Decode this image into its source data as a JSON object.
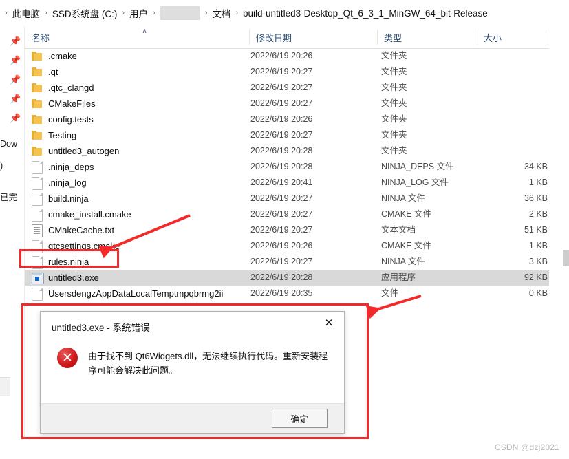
{
  "window": {
    "title": "build-untitled3-Desktop_Qt_6_3_1_MinGW_64_bit-Release"
  },
  "breadcrumb": {
    "separator": "›",
    "items": [
      {
        "label": "此电脑",
        "redacted": false
      },
      {
        "label": "SSD系统盘 (C:)",
        "redacted": false
      },
      {
        "label": "用户",
        "redacted": false
      },
      {
        "label": "",
        "redacted": true
      },
      {
        "label": "文档",
        "redacted": false
      },
      {
        "label": "build-untitled3-Desktop_Qt_6_3_1_MinGW_64_bit-Release",
        "redacted": false
      }
    ]
  },
  "columns": {
    "name": "名称",
    "date_modified": "修改日期",
    "type": "类型",
    "size": "大小",
    "sort_caret": "∧"
  },
  "left_rail": {
    "pin_icon": "📌",
    "fragments": [
      "Dow",
      ")",
      "已完"
    ]
  },
  "files": [
    {
      "name": ".cmake",
      "icon": "folder",
      "date": "2022/6/19 20:26",
      "type": "文件夹",
      "size": "",
      "selected": false
    },
    {
      "name": ".qt",
      "icon": "folder",
      "date": "2022/6/19 20:27",
      "type": "文件夹",
      "size": "",
      "selected": false
    },
    {
      "name": ".qtc_clangd",
      "icon": "folder",
      "date": "2022/6/19 20:27",
      "type": "文件夹",
      "size": "",
      "selected": false
    },
    {
      "name": "CMakeFiles",
      "icon": "folder",
      "date": "2022/6/19 20:27",
      "type": "文件夹",
      "size": "",
      "selected": false
    },
    {
      "name": "config.tests",
      "icon": "folder",
      "date": "2022/6/19 20:26",
      "type": "文件夹",
      "size": "",
      "selected": false
    },
    {
      "name": "Testing",
      "icon": "folder",
      "date": "2022/6/19 20:27",
      "type": "文件夹",
      "size": "",
      "selected": false
    },
    {
      "name": "untitled3_autogen",
      "icon": "folder",
      "date": "2022/6/19 20:28",
      "type": "文件夹",
      "size": "",
      "selected": false
    },
    {
      "name": ".ninja_deps",
      "icon": "file",
      "date": "2022/6/19 20:28",
      "type": "NINJA_DEPS 文件",
      "size": "34 KB",
      "selected": false
    },
    {
      "name": ".ninja_log",
      "icon": "file",
      "date": "2022/6/19 20:41",
      "type": "NINJA_LOG 文件",
      "size": "1 KB",
      "selected": false
    },
    {
      "name": "build.ninja",
      "icon": "file",
      "date": "2022/6/19 20:27",
      "type": "NINJA 文件",
      "size": "36 KB",
      "selected": false
    },
    {
      "name": "cmake_install.cmake",
      "icon": "file",
      "date": "2022/6/19 20:27",
      "type": "CMAKE 文件",
      "size": "2 KB",
      "selected": false
    },
    {
      "name": "CMakeCache.txt",
      "icon": "txt",
      "date": "2022/6/19 20:27",
      "type": "文本文档",
      "size": "51 KB",
      "selected": false
    },
    {
      "name": "qtcsettings.cmake",
      "icon": "file",
      "date": "2022/6/19 20:26",
      "type": "CMAKE 文件",
      "size": "1 KB",
      "selected": false
    },
    {
      "name": "rules.ninja",
      "icon": "file",
      "date": "2022/6/19 20:27",
      "type": "NINJA 文件",
      "size": "3 KB",
      "selected": false
    },
    {
      "name": "untitled3.exe",
      "icon": "exe",
      "date": "2022/6/19 20:28",
      "type": "应用程序",
      "size": "92 KB",
      "selected": true
    },
    {
      "name": "UsersdengzAppDataLocalTemptmpqbrmg2ii",
      "icon": "file",
      "date": "2022/6/19 20:35",
      "type": "文件",
      "size": "0 KB",
      "selected": false
    }
  ],
  "dialog": {
    "title": "untitled3.exe - 系统错误",
    "close_label": "✕",
    "error_glyph": "✕",
    "message": "由于找不到 Qt6Widgets.dll，无法继续执行代码。重新安装程序可能会解决此问题。",
    "ok_label": "确定"
  },
  "annotations": {
    "highlight_color": "#f42a2a",
    "arrow_color": "#f42a2a"
  },
  "watermark": "CSDN @dzj2021"
}
